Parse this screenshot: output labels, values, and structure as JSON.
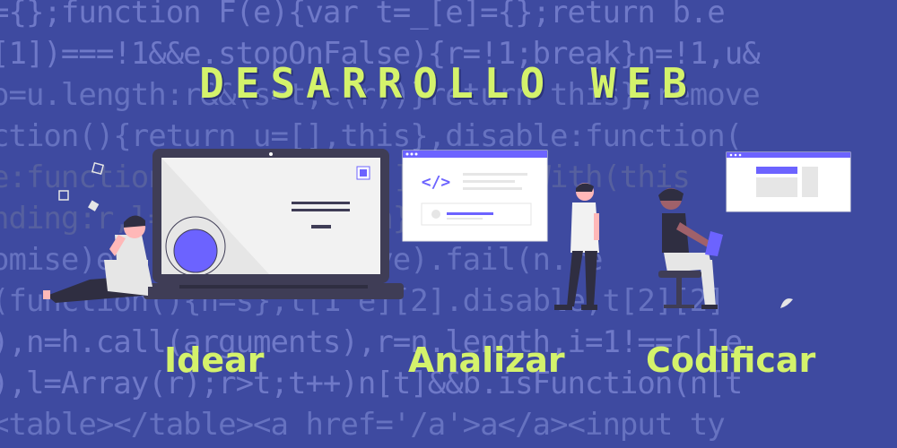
{
  "background": {
    "color": "#3e4aa0",
    "code_lines": [
      "={};function F(e){var t=_[e]={};return b.e",
      "[1])===!1&&e.stopOnFalse){r=!1;break}n=!1,u&",
      "o=u.length:r&&(s=t,c(r))}return this},remove",
      "ction(){return u=[],this},disable:function(",
      "e:function(){return u=[],this},With(this",
      "nding:r,l=this;return n},always",
      "omise)e(n.done(n.resolve).fail(n.re",
      "(function(){n=s},t[1^e][2].disable,t[2][2]",
      "),n=h.call(arguments),r=n.length,i=1!==r|le",
      "),l=Array(r);r>t;t++)n[t]&&b.isFunction(n[t",
      "<table></table><a href='/a'>a</a><input ty"
    ]
  },
  "title": "DESARROLLO WEB",
  "accent_color": "#d4f26b",
  "steps": [
    {
      "label": "Idear",
      "illustration": "person-with-laptop-icon"
    },
    {
      "label": "Analizar",
      "illustration": "person-with-browser-window-icon"
    },
    {
      "label": "Codificar",
      "illustration": "person-coding-on-chair-icon"
    }
  ],
  "browser_window_1": {
    "code_symbol": "</>"
  }
}
